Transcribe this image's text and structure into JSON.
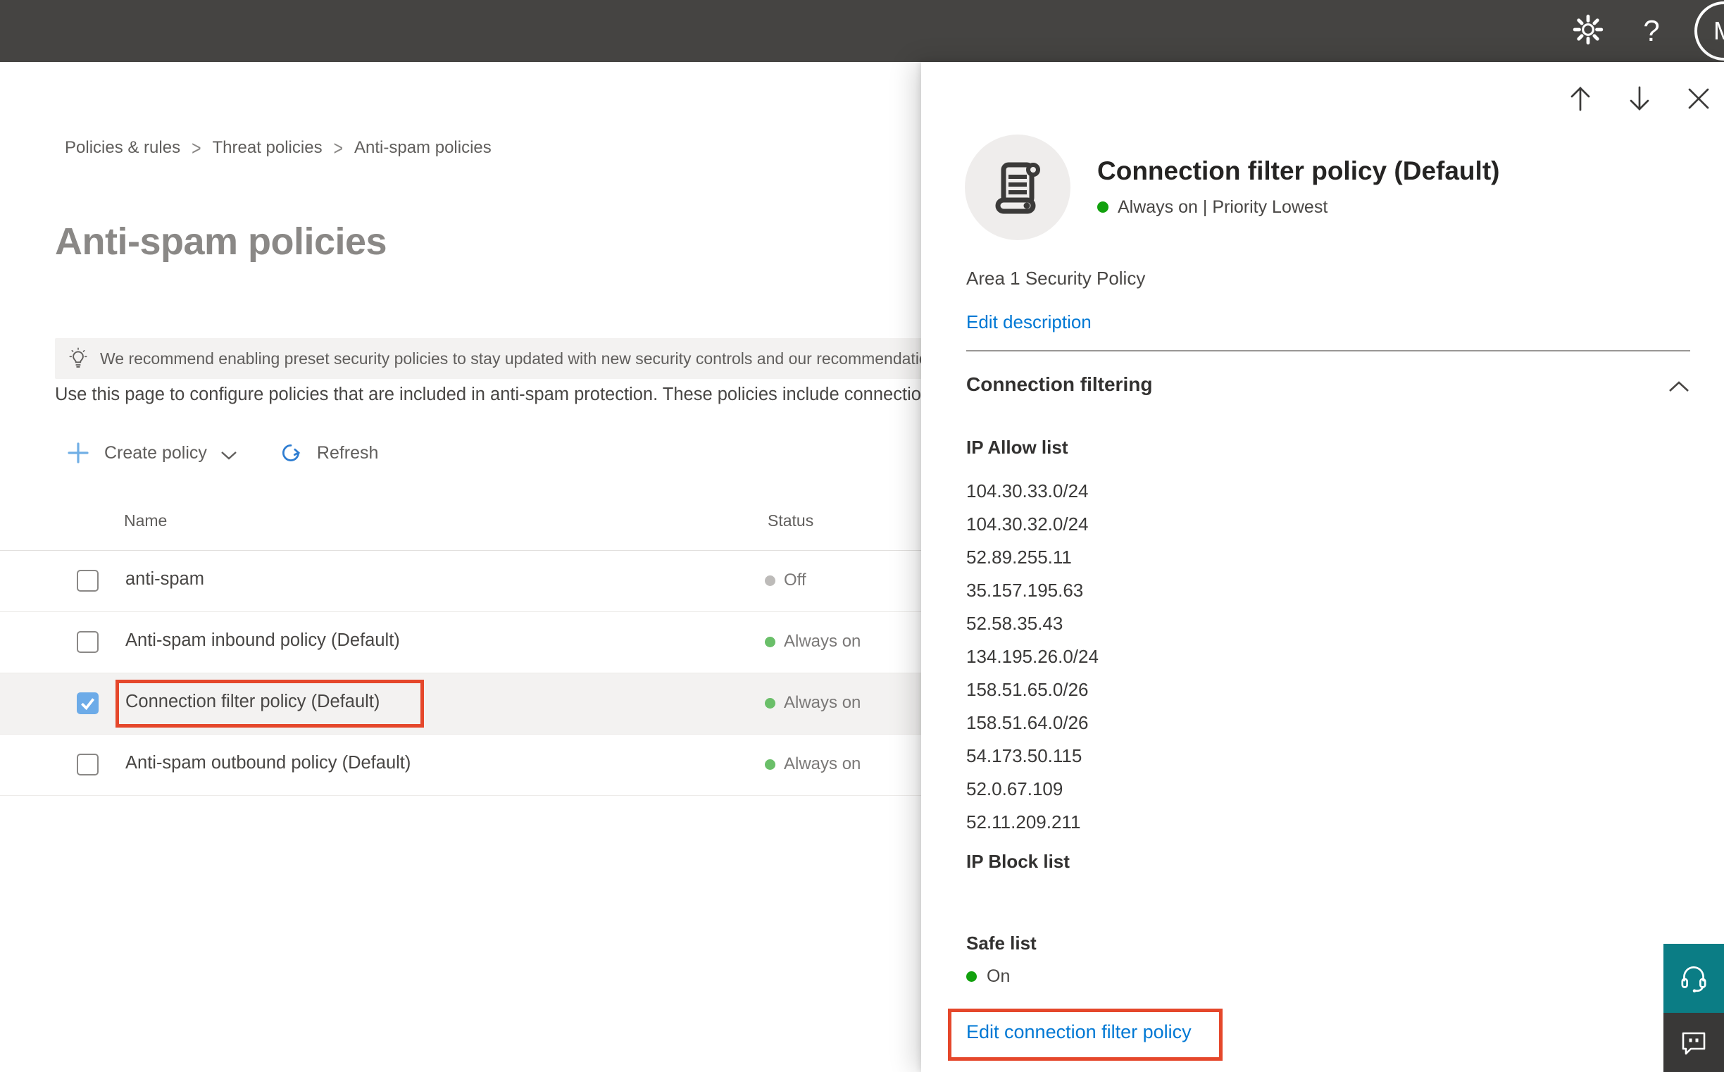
{
  "topbar": {
    "avatar_initial": "M",
    "help_glyph": "?",
    "icons": [
      "gear-icon",
      "help-icon",
      "account-avatar"
    ]
  },
  "breadcrumb": {
    "items": [
      "Policies & rules",
      "Threat policies",
      "Anti-spam policies"
    ],
    "separator": ">"
  },
  "page": {
    "title": "Anti-spam policies",
    "banner_text": "We recommend enabling preset security policies to stay updated with new security controls and our recommendations.",
    "description": "Use this page to configure policies that are included in anti-spam protection. These policies include connection filtering, spam filtering, and outbound spam filtering.",
    "toolbar": {
      "create_policy_label": "Create policy",
      "refresh_label": "Refresh"
    }
  },
  "table": {
    "columns": [
      "Name",
      "Status"
    ],
    "rows": [
      {
        "name": "anti-spam",
        "status": "Off",
        "status_type": "off",
        "checked": false,
        "selected": false,
        "annotated": false
      },
      {
        "name": "Anti-spam inbound policy (Default)",
        "status": "Always on",
        "status_type": "on",
        "checked": false,
        "selected": false,
        "annotated": false
      },
      {
        "name": "Connection filter policy (Default)",
        "status": "Always on",
        "status_type": "on",
        "checked": true,
        "selected": true,
        "annotated": true
      },
      {
        "name": "Anti-spam outbound policy (Default)",
        "status": "Always on",
        "status_type": "on",
        "checked": false,
        "selected": false,
        "annotated": false
      }
    ]
  },
  "flyout": {
    "nav_icons": [
      "arrow-up",
      "arrow-down",
      "close-x"
    ],
    "title": "Connection filter policy (Default)",
    "status_line": "Always on | Priority Lowest",
    "description": "Area 1 Security Policy",
    "edit_description_label": "Edit description",
    "section_title": "Connection filtering",
    "ip_allow_label": "IP Allow list",
    "ip_allow_list": [
      "104.30.33.0/24",
      "104.30.32.0/24",
      "52.89.255.11",
      "35.157.195.63",
      "52.58.35.43",
      "134.195.26.0/24",
      "158.51.65.0/26",
      "158.51.64.0/26",
      "54.173.50.115",
      "52.0.67.109",
      "52.11.209.211"
    ],
    "ip_block_label": "IP Block list",
    "safe_list_label": "Safe list",
    "safe_list_status": "On",
    "edit_policy_label": "Edit connection filter policy"
  },
  "colors": {
    "topbar_bg": "#454442",
    "accent_blue": "#0078d4",
    "checkbox_checked_blue": "#6cabe8",
    "status_on_table_green": "#6abf69",
    "status_on_flyout_green": "#12a10e",
    "status_off_gray": "#bdbbb9",
    "annotation_red": "#e5472b",
    "selected_row_bg": "#f3f2f1",
    "support_teal": "#0b7d85",
    "feedback_dark": "#393837"
  }
}
